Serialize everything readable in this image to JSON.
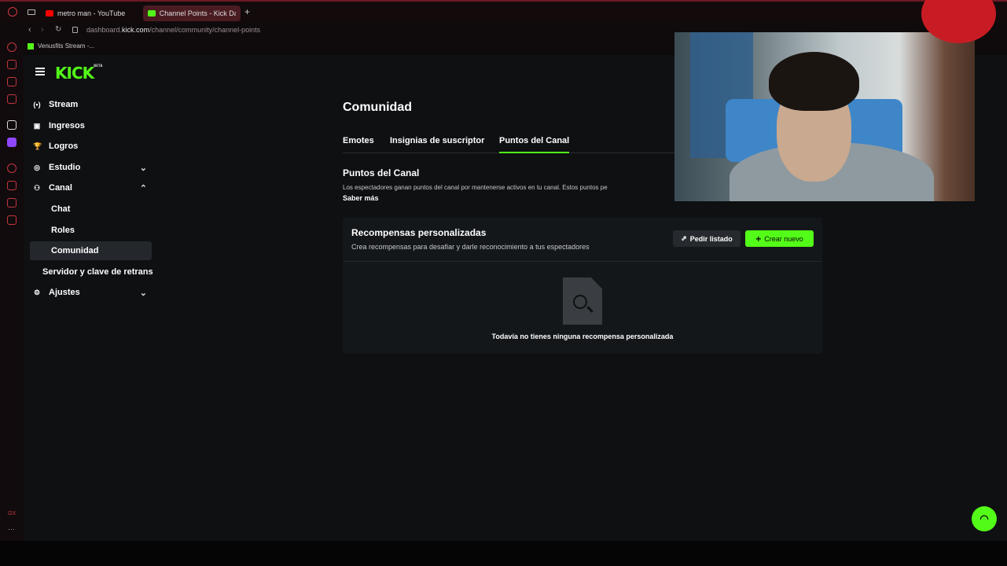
{
  "browser": {
    "tabs": [
      {
        "label": "metro man - YouTube",
        "color": "#ff0000"
      },
      {
        "label": "Channel Points - Kick Da",
        "color": "#53fc18"
      }
    ],
    "new_tab": "+",
    "url_prefix": "dashboard.",
    "url_domain": "kick.com",
    "url_path": "/channel/community/channel-points",
    "bookmark": "Venusfits Stream -..."
  },
  "brand": {
    "logo": "KICK",
    "badge": "BETA",
    "accent": "#53fc18"
  },
  "sidebar": {
    "items": [
      {
        "label": "Stream",
        "icon": "broadcast-icon",
        "glyph": "(•)"
      },
      {
        "label": "Ingresos",
        "icon": "money-icon",
        "glyph": "▣"
      },
      {
        "label": "Logros",
        "icon": "trophy-icon",
        "glyph": "🏆"
      },
      {
        "label": "Estudio",
        "icon": "studio-icon",
        "glyph": "◎"
      },
      {
        "label": "Canal",
        "icon": "channel-icon",
        "glyph": "⚇"
      },
      {
        "label": "Chat"
      },
      {
        "label": "Roles"
      },
      {
        "label": "Comunidad"
      },
      {
        "label": "Servidor y clave de retrans"
      },
      {
        "label": "Ajustes",
        "icon": "gear-icon",
        "glyph": "⚙"
      }
    ]
  },
  "page": {
    "title": "Comunidad",
    "tabs": [
      "Emotes",
      "Insignias de suscriptor",
      "Puntos del Canal"
    ],
    "section_title": "Puntos del Canal",
    "section_desc": "Los espectadores ganan puntos del canal por mantenerse activos en tu canal. Estos puntos pe",
    "learn_more": "Saber más"
  },
  "rewards": {
    "title": "Recompensas personalizadas",
    "subtitle": "Crea recompensas para desafiar y darle reconocimiento a tus espectadores",
    "request_button": "Pedir listado",
    "create_button": "Crear nuevo",
    "empty_text": "Todavía no tienes ninguna recompensa personalizada"
  }
}
